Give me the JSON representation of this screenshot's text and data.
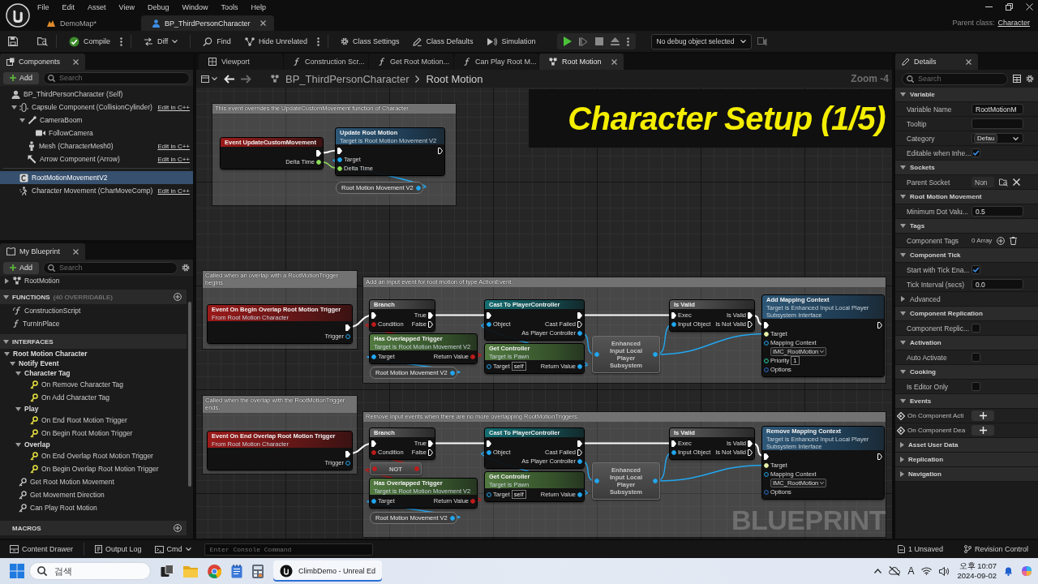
{
  "menu_bar": {
    "items": [
      "File",
      "Edit",
      "Asset",
      "View",
      "Debug",
      "Window",
      "Tools",
      "Help"
    ]
  },
  "document_tabs": [
    {
      "label": "DemoMap*",
      "selected": false
    },
    {
      "label": "BP_ThirdPersonCharacter",
      "selected": true
    }
  ],
  "parent_class": {
    "label": "Parent class:",
    "value": "Character"
  },
  "toolbar": {
    "compile": "Compile",
    "diff": "Diff",
    "find": "Find",
    "hide_unrelated": "Hide Unrelated",
    "class_settings": "Class Settings",
    "class_defaults": "Class Defaults",
    "simulation": "Simulation",
    "debug_object": "No debug object selected"
  },
  "components": {
    "tab": "Components",
    "add": "Add",
    "search_placeholder": "Search",
    "tree": [
      {
        "label": "BP_ThirdPersonCharacter (Self)",
        "kind": "self",
        "selected": false,
        "children": [
          {
            "label": "Capsule Component (CollisionCylinder)",
            "kind": "capsule",
            "selected": false,
            "expanded": true,
            "edit_link": "Edit in C++",
            "children": [
              {
                "label": "CameraBoom",
                "kind": "spring-arm",
                "selected": false,
                "expanded": true,
                "children": [
                  {
                    "label": "FollowCamera",
                    "kind": "camera",
                    "selected": false
                  }
                ]
              },
              {
                "label": "Mesh (CharacterMesh0)",
                "kind": "mesh",
                "selected": false,
                "edit_link": "Edit in C++"
              },
              {
                "label": "Arrow Component (Arrow)",
                "kind": "arrow",
                "selected": false,
                "edit_link": "Edit in C++"
              }
            ]
          }
        ]
      }
    ],
    "other": [
      {
        "label": "RootMotionMovementV2",
        "kind": "component",
        "selected": true
      },
      {
        "label": "Character Movement (CharMoveComp)",
        "kind": "movement",
        "selected": false,
        "edit_link": "Edit in C++"
      }
    ]
  },
  "my_blueprint": {
    "tab": "My Blueprint",
    "add": "Add",
    "search_placeholder": "Search",
    "graphs": [
      {
        "label": "RootMotion",
        "kind": "graph",
        "expanded": false,
        "selected": false
      }
    ],
    "sections": [
      {
        "title": "FUNCTIONS",
        "note": "(40 OVERRIDABLE)",
        "expanded": true,
        "can_add": true,
        "items": [
          {
            "label": "ConstructionScript",
            "kind": "construction",
            "selected": false
          },
          {
            "label": "TurnInPlace",
            "kind": "function",
            "selected": false
          }
        ]
      },
      {
        "title": "INTERFACES",
        "expanded": true,
        "can_add": false,
        "items": [
          {
            "label": "Root Motion Character",
            "kind": "category",
            "expanded": true,
            "selected": false,
            "children": [
              {
                "label": "Notify Event",
                "kind": "category",
                "expanded": true,
                "selected": false,
                "children": [
                  {
                    "label": "Character Tag",
                    "kind": "category",
                    "expanded": true,
                    "selected": false,
                    "children": [
                      {
                        "label": "On Remove Character Tag",
                        "kind": "event",
                        "selected": false
                      },
                      {
                        "label": "On Add Character Tag",
                        "kind": "event",
                        "selected": false
                      }
                    ]
                  },
                  {
                    "label": "Play",
                    "kind": "category",
                    "expanded": true,
                    "selected": false,
                    "children": [
                      {
                        "label": "On End Root Motion Trigger",
                        "kind": "event",
                        "selected": false
                      },
                      {
                        "label": "On Begin Root Motion Trigger",
                        "kind": "event",
                        "selected": false
                      }
                    ]
                  },
                  {
                    "label": "Overlap",
                    "kind": "category",
                    "expanded": true,
                    "selected": false,
                    "children": [
                      {
                        "label": "On End Overlap Root Motion Trigger",
                        "kind": "event",
                        "selected": false
                      },
                      {
                        "label": "On Begin Overlap Root Motion Trigger",
                        "kind": "event",
                        "selected": false
                      }
                    ]
                  }
                ]
              },
              {
                "label": "Get Root Motion Movement",
                "kind": "interface",
                "selected": false
              },
              {
                "label": "Get Movement Direction",
                "kind": "interface",
                "selected": false
              },
              {
                "label": "Can Play Root Motion",
                "kind": "interface",
                "selected": false
              }
            ]
          }
        ]
      },
      {
        "title": "MACROS",
        "can_add": true
      }
    ]
  },
  "graph_tabs": [
    {
      "label": "Viewport",
      "kind": "viewport",
      "selected": false
    },
    {
      "label": "Construction Scr...",
      "kind": "function",
      "selected": false
    },
    {
      "label": "Get Root Motion...",
      "kind": "function",
      "selected": false
    },
    {
      "label": "Can Play Root M...",
      "kind": "function",
      "selected": false
    },
    {
      "label": "Root Motion",
      "kind": "graph",
      "selected": true
    }
  ],
  "breadcrumb": {
    "blueprint": "BP_ThirdPersonCharacter",
    "graph": "Root Motion",
    "zoom": "Zoom -4"
  },
  "graph": {
    "overlay_title": "Character Setup (1/5)",
    "watermark": "BLUEPRINT",
    "comments": [
      "This event overrides the UpdateCustomMovement function of Character.",
      "Called when an overlap with a RootMotionTrigger begins.",
      "Add an input event for root motion of type ActionEvent.",
      "Called when the overlap with the RootMotionTrigger ends.",
      "Remove input events when there are no more overlapping RootMotionTriggers."
    ],
    "nodes": [
      {
        "kind": "event",
        "title": "Event UpdateCustomMovement",
        "outputs": [
          {
            "kind": "exec",
            "connected": true
          },
          {
            "kind": "float",
            "label": "Delta Time",
            "connected": true
          }
        ]
      },
      {
        "kind": "function",
        "title": "Update Root Motion",
        "subtitle": "Target is Root Motion Movement V2",
        "inputs": [
          {
            "kind": "exec",
            "connected": true
          },
          {
            "kind": "object",
            "label": "Target",
            "connected": true
          },
          {
            "kind": "float",
            "label": "Delta Time",
            "connected": true
          }
        ],
        "outputs": [
          {
            "kind": "exec",
            "connected": false
          }
        ]
      },
      {
        "kind": "variable",
        "title": "Root Motion Movement V2",
        "outputs": [
          {
            "kind": "object",
            "connected": true
          }
        ]
      },
      {
        "kind": "event",
        "title": "Event On Begin Overlap Root Motion Trigger",
        "subtitle": "From Root Motion Character",
        "outputs": [
          {
            "kind": "exec",
            "connected": true
          },
          {
            "kind": "object",
            "label": "Trigger",
            "connected": false
          }
        ]
      },
      {
        "kind": "macro",
        "title": "Branch",
        "inputs": [
          {
            "kind": "exec",
            "connected": true
          },
          {
            "kind": "bool",
            "label": "Condition",
            "connected": true
          }
        ],
        "outputs": [
          {
            "kind": "exec",
            "label": "True",
            "connected": true
          },
          {
            "kind": "exec",
            "label": "False",
            "connected": false
          }
        ]
      },
      {
        "kind": "pure",
        "title": "Has Overlapped Trigger",
        "subtitle": "Target is Root Motion Movement V2",
        "inputs": [
          {
            "kind": "object",
            "label": "Target",
            "connected": true
          }
        ],
        "outputs": [
          {
            "kind": "bool",
            "label": "Return Value",
            "connected": true
          }
        ]
      },
      {
        "kind": "variable",
        "title": "Root Motion Movement V2",
        "outputs": [
          {
            "kind": "object",
            "connected": true
          }
        ]
      },
      {
        "kind": "cast",
        "title": "Cast To PlayerController",
        "inputs": [
          {
            "kind": "exec",
            "connected": true
          },
          {
            "kind": "object",
            "label": "Object",
            "connected": true
          }
        ],
        "outputs": [
          {
            "kind": "exec",
            "connected": true
          },
          {
            "kind": "exec",
            "label": "Cast Failed",
            "connected": false
          },
          {
            "kind": "object",
            "label": "As Player Controller",
            "connected": true
          }
        ]
      },
      {
        "kind": "pure",
        "title": "Get Controller",
        "subtitle": "Target is Pawn",
        "inputs": [
          {
            "kind": "object",
            "label": "Target",
            "connected": false,
            "value": "self"
          }
        ],
        "outputs": [
          {
            "kind": "object",
            "label": "Return Value",
            "connected": true
          }
        ]
      },
      {
        "kind": "compact",
        "title": "Enhanced Input Local Player Subsystem",
        "inputs": [
          {
            "kind": "object",
            "connected": true
          }
        ],
        "outputs": [
          {
            "kind": "object",
            "connected": true
          }
        ]
      },
      {
        "kind": "macro",
        "title": "Is Valid",
        "inputs": [
          {
            "kind": "exec",
            "label": "Exec",
            "connected": true
          },
          {
            "kind": "object",
            "label": "Input Object",
            "connected": true
          }
        ],
        "outputs": [
          {
            "kind": "exec",
            "label": "Is Valid",
            "connected": true
          },
          {
            "kind": "exec",
            "label": "Is Not Valid",
            "connected": false
          }
        ]
      },
      {
        "kind": "function",
        "title": "Add Mapping Context",
        "subtitle": "Target is Enhanced Input Local Player Subsystem Interface",
        "inputs": [
          {
            "kind": "exec",
            "connected": true
          },
          {
            "kind": "interface",
            "label": "Target",
            "connected": true
          },
          {
            "kind": "object",
            "label": "Mapping Context",
            "connected": false,
            "asset": "IMC_RootMotion"
          },
          {
            "kind": "int",
            "label": "Priority",
            "connected": false,
            "value": "1"
          },
          {
            "kind": "struct",
            "label": "Options",
            "connected": false
          }
        ],
        "outputs": [
          {
            "kind": "exec",
            "connected": false
          }
        ]
      },
      {
        "kind": "event",
        "title": "Event On End Overlap Root Motion Trigger",
        "subtitle": "From Root Motion Character",
        "outputs": [
          {
            "kind": "exec",
            "connected": true
          },
          {
            "kind": "object",
            "label": "Trigger",
            "connected": false
          }
        ]
      },
      {
        "kind": "macro",
        "title": "Branch",
        "inputs": [
          {
            "kind": "exec",
            "connected": true
          },
          {
            "kind": "bool",
            "label": "Condition",
            "connected": true
          }
        ],
        "outputs": [
          {
            "kind": "exec",
            "label": "True",
            "connected": true
          },
          {
            "kind": "exec",
            "label": "False",
            "connected": false
          }
        ]
      },
      {
        "kind": "compact",
        "title": "NOT",
        "inputs": [
          {
            "kind": "bool",
            "connected": true
          }
        ],
        "outputs": [
          {
            "kind": "bool",
            "connected": true
          }
        ]
      },
      {
        "kind": "pure",
        "title": "Has Overlapped Trigger",
        "subtitle": "Target is Root Motion Movement V2",
        "inputs": [
          {
            "kind": "object",
            "label": "Target",
            "connected": true
          }
        ],
        "outputs": [
          {
            "kind": "bool",
            "label": "Return Value",
            "connected": true
          }
        ]
      },
      {
        "kind": "variable",
        "title": "Root Motion Movement V2",
        "outputs": [
          {
            "kind": "object",
            "connected": true
          }
        ]
      },
      {
        "kind": "cast",
        "title": "Cast To PlayerController",
        "inputs": [
          {
            "kind": "exec",
            "connected": true
          },
          {
            "kind": "object",
            "label": "Object",
            "connected": true
          }
        ],
        "outputs": [
          {
            "kind": "exec",
            "connected": true
          },
          {
            "kind": "exec",
            "label": "Cast Failed",
            "connected": false
          },
          {
            "kind": "object",
            "label": "As Player Controller",
            "connected": true
          }
        ]
      },
      {
        "kind": "pure",
        "title": "Get Controller",
        "subtitle": "Target is Pawn",
        "inputs": [
          {
            "kind": "object",
            "label": "Target",
            "connected": false,
            "value": "self"
          }
        ],
        "outputs": [
          {
            "kind": "object",
            "label": "Return Value",
            "connected": true
          }
        ]
      },
      {
        "kind": "compact",
        "title": "Enhanced Input Local Player Subsystem",
        "inputs": [
          {
            "kind": "object",
            "connected": true
          }
        ],
        "outputs": [
          {
            "kind": "object",
            "connected": true
          }
        ]
      },
      {
        "kind": "macro",
        "title": "Is Valid",
        "inputs": [
          {
            "kind": "exec",
            "label": "Exec",
            "connected": true
          },
          {
            "kind": "object",
            "label": "Input Object",
            "connected": true
          }
        ],
        "outputs": [
          {
            "kind": "exec",
            "label": "Is Valid",
            "connected": true
          },
          {
            "kind": "exec",
            "label": "Is Not Valid",
            "connected": false
          }
        ]
      },
      {
        "kind": "function",
        "title": "Remove Mapping Context",
        "subtitle": "Target is Enhanced Input Local Player Subsystem Interface",
        "inputs": [
          {
            "kind": "exec",
            "connected": true
          },
          {
            "kind": "interface",
            "label": "Target",
            "connected": true
          },
          {
            "kind": "object",
            "label": "Mapping Context",
            "connected": false,
            "asset": "IMC_RootMotion"
          },
          {
            "kind": "struct",
            "label": "Options",
            "connected": false
          }
        ],
        "outputs": [
          {
            "kind": "exec",
            "connected": false
          }
        ]
      }
    ]
  },
  "details": {
    "tab": "Details",
    "search_placeholder": "Search",
    "sections": [
      {
        "title": "Variable",
        "expanded": true,
        "rows": [
          {
            "kind": "text",
            "label": "Variable Name",
            "value": "RootMotionM"
          },
          {
            "kind": "text",
            "label": "Tooltip"
          },
          {
            "kind": "dropdown",
            "label": "Category",
            "value": "Defau"
          },
          {
            "kind": "checkbox",
            "label": "Editable when Inhe...",
            "checked": true
          }
        ]
      },
      {
        "title": "Sockets",
        "expanded": true,
        "rows": [
          {
            "kind": "socket",
            "label": "Parent Socket",
            "value": "Non"
          }
        ]
      },
      {
        "title": "Root Motion Movement",
        "expanded": true,
        "rows": [
          {
            "kind": "text",
            "label": "Minimum Dot Valu...",
            "value": "0.5"
          }
        ]
      },
      {
        "title": "Tags",
        "expanded": true,
        "rows": [
          {
            "kind": "array",
            "label": "Component Tags",
            "value": "0 Array"
          }
        ]
      },
      {
        "title": "Component Tick",
        "expanded": true,
        "rows": [
          {
            "kind": "checkbox",
            "label": "Start with Tick Ena...",
            "checked": true
          },
          {
            "kind": "text",
            "label": "Tick Interval (secs)",
            "value": "0.0"
          },
          {
            "kind": "expander",
            "label": "Advanced",
            "expanded": false
          }
        ]
      },
      {
        "title": "Component Replication",
        "expanded": true,
        "rows": [
          {
            "kind": "checkbox",
            "label": "Component Replic...",
            "checked": false
          }
        ]
      },
      {
        "title": "Activation",
        "expanded": true,
        "rows": [
          {
            "kind": "checkbox",
            "label": "Auto Activate",
            "checked": false
          }
        ]
      },
      {
        "title": "Cooking",
        "expanded": true,
        "rows": [
          {
            "kind": "checkbox",
            "label": "Is Editor Only",
            "checked": false
          }
        ]
      },
      {
        "title": "Events",
        "expanded": true,
        "rows": [
          {
            "kind": "event",
            "label": "On Component Acti"
          },
          {
            "kind": "event",
            "label": "On Component Dea"
          }
        ]
      },
      {
        "title": "Asset User Data",
        "expanded": false
      },
      {
        "title": "Replication",
        "expanded": false
      },
      {
        "title": "Navigation",
        "expanded": false
      }
    ]
  },
  "status_bar": {
    "content_drawer": "Content Drawer",
    "output_log": "Output Log",
    "cmd": "Cmd",
    "console_placeholder": "Enter Console Command",
    "unsaved": "1 Unsaved",
    "revision_control": "Revision Control"
  },
  "taskbar": {
    "search_placeholder": "검색",
    "running_apps": [
      {
        "label": "ClimbDemo - Unreal Ed",
        "selected": true
      }
    ],
    "ime": "A",
    "time": "오후 10:07",
    "date": "2024-09-02"
  }
}
